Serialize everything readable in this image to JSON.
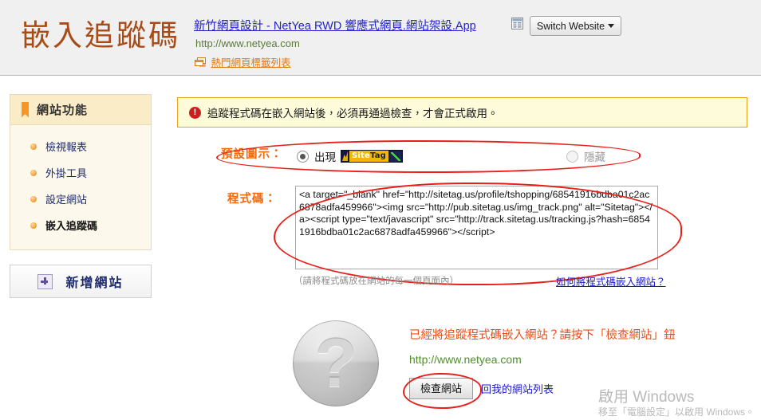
{
  "header": {
    "page_title": "嵌入追蹤碼",
    "site_link": "新竹網頁設計 - NetYea RWD 響應式網頁.網站架設.App",
    "site_link_icon": "window-list-icon",
    "site_url": "http://www.netyea.com",
    "hot_tags_label": "熱門網頁標籤列表",
    "hot_tags_icon": "windows-stack-icon",
    "switch_website_label": "Switch Website",
    "switch_caret_icon": "chevron-down-icon"
  },
  "sidebar": {
    "title": "網站功能",
    "items": [
      {
        "label": "檢視報表"
      },
      {
        "label": "外掛工具"
      },
      {
        "label": "設定網站"
      },
      {
        "label": "嵌入追蹤碼"
      }
    ],
    "add_site_label": "新增網站",
    "add_site_icon": "plus-icon"
  },
  "notice": {
    "icon": "warning-icon",
    "icon_glyph": "!",
    "text": "追蹤程式碼在嵌入網站後，必須再通過檢查，才會正式啟用。"
  },
  "icon_setting": {
    "label": "預設圖示：",
    "show_option": "出現",
    "hide_option": "隱藏",
    "selected": "出現",
    "badge": {
      "name": "sitetag-badge",
      "text_site": "Site",
      "text_tag": "Tag",
      "chart_icon": "green-chart-arrow-icon"
    }
  },
  "code_section": {
    "label": "程式碼：",
    "code": "<a target=\"_blank\" href=\"http://sitetag.us/profile/tshopping/68541916bdba01c2ac6878adfa459966\"><img src=\"http://pub.sitetag.us/img_track.png\" alt=\"Sitetag\"></a><script type=\"text/javascript\" src=\"http://track.sitetag.us/tracking.js?hash=68541916bdba01c2ac6878adfa459966\"></scr",
    "code_tail": "ipt>",
    "hint_left": "（請將程式碼放在網站的每一個頁面內）",
    "hint_right": "如何將程式碼嵌入網站？"
  },
  "bottom": {
    "question_icon": "question-mark-icon",
    "question_glyph": "?",
    "cta_text": "已經將追蹤程式碼嵌入網站？請按下「檢查網站」鈕",
    "cta_url": "http://www.netyea.com",
    "check_button_label": "檢查網站",
    "back_list_label": "回我的網站列表"
  },
  "watermark": {
    "title": "啟用 Windows",
    "subtitle": "移至「電腦設定」以啟用 Windows。"
  },
  "colors": {
    "accent_orange": "#f06a10",
    "title_brown": "#a84b17",
    "link_blue": "#2222cc",
    "notice_bg": "#fdfbd9",
    "notice_border": "#e8a317",
    "annotation_red": "#e8201a",
    "url_green": "#5a7a3a"
  }
}
